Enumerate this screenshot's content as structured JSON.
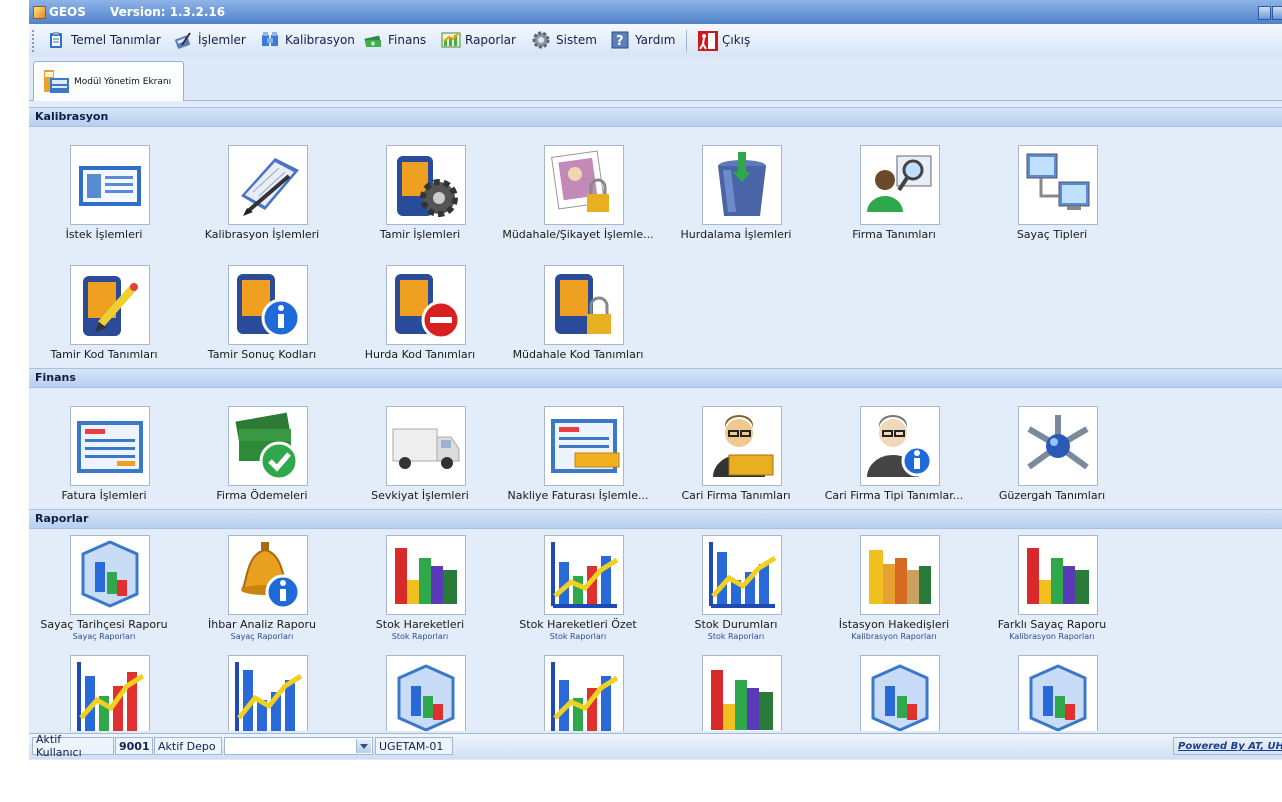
{
  "window": {
    "app_name": "GEOS",
    "version": "Version: 1.3.2.16"
  },
  "menu": [
    {
      "label": "Temel Tanımlar",
      "icon": "clipboard-icon"
    },
    {
      "label": "İşlemler",
      "icon": "calculator-pen-icon"
    },
    {
      "label": "Kalibrasyon",
      "icon": "meter-icon"
    },
    {
      "label": "Finans",
      "icon": "money-icon"
    },
    {
      "label": "Raporlar",
      "icon": "chart-icon"
    },
    {
      "label": "Sistem",
      "icon": "gear-icon"
    },
    {
      "label": "Yardım",
      "icon": "help-icon"
    },
    {
      "label": "Çıkış",
      "icon": "exit-icon"
    }
  ],
  "tab": {
    "label": "Modül Yönetim Ekranı"
  },
  "sections": [
    {
      "title": "Kalibrasyon",
      "items": [
        {
          "label": "İstek İşlemleri",
          "icon": "document-list-icon"
        },
        {
          "label": "Kalibrasyon İşlemleri",
          "icon": "notebook-pen-icon"
        },
        {
          "label": "Tamir İşlemleri",
          "icon": "device-gear-icon"
        },
        {
          "label": "Müdahale/Şikayet İşlemle...",
          "icon": "photo-lock-icon"
        },
        {
          "label": "Hurdalama İşlemleri",
          "icon": "recycle-bin-icon"
        },
        {
          "label": "Firma Tanımları",
          "icon": "person-search-icon"
        },
        {
          "label": "Sayaç Tipleri",
          "icon": "network-computers-icon"
        },
        {
          "label": "Tamir Kod Tanımları",
          "icon": "device-pencil-icon"
        },
        {
          "label": "Tamir Sonuç Kodları",
          "icon": "device-info-icon"
        },
        {
          "label": "Hurda Kod Tanımları",
          "icon": "device-stop-icon"
        },
        {
          "label": "Müdahale Kod Tanımları",
          "icon": "device-lock-icon"
        }
      ]
    },
    {
      "title": "Finans",
      "items": [
        {
          "label": "Fatura İşlemleri",
          "icon": "invoice-icon"
        },
        {
          "label": "Firma Ödemeleri",
          "icon": "money-check-icon"
        },
        {
          "label": "Sevkiyat İşlemleri",
          "icon": "delivery-truck-icon"
        },
        {
          "label": "Nakliye Faturası İşlemle...",
          "icon": "invoice-card-icon"
        },
        {
          "label": "Cari Firma Tanımları",
          "icon": "user-folder-icon"
        },
        {
          "label": "Cari Firma Tipi Tanımlar...",
          "icon": "user-info-icon"
        },
        {
          "label": "Güzergah Tanımları",
          "icon": "routes-hub-icon"
        }
      ]
    },
    {
      "title": "Raporlar",
      "items": [
        {
          "label": "Sayaç Tarihçesi Raporu",
          "sub": "Sayaç Raporları",
          "icon": "chart-3d-icon"
        },
        {
          "label": "İhbar Analiz Raporu",
          "sub": "Sayaç Raporları",
          "icon": "bell-info-icon"
        },
        {
          "label": "Stok Hareketleri",
          "sub": "Stok Raporları",
          "icon": "bar-chart-icon"
        },
        {
          "label": "Stok Hareketleri Özet",
          "sub": "Stok Raporları",
          "icon": "line-chart-icon"
        },
        {
          "label": "Stok Durumları",
          "sub": "Stok Raporları",
          "icon": "line-chart-icon"
        },
        {
          "label": "İstasyon Hakedişleri",
          "sub": "Kalibrasyon Raporları",
          "icon": "bar-chart-warm-icon"
        },
        {
          "label": "Farklı Sayaç Raporu",
          "sub": "Kalibrasyon Raporları",
          "icon": "bar-chart-icon"
        },
        {
          "label": "",
          "sub": "",
          "icon": "line-chart-icon"
        },
        {
          "label": "",
          "sub": "",
          "icon": "line-chart-icon"
        },
        {
          "label": "",
          "sub": "",
          "icon": "chart-3d-icon"
        },
        {
          "label": "",
          "sub": "",
          "icon": "line-chart-icon"
        },
        {
          "label": "",
          "sub": "",
          "icon": "bar-chart-icon"
        },
        {
          "label": "",
          "sub": "",
          "icon": "chart-3d-icon"
        },
        {
          "label": "",
          "sub": "",
          "icon": "chart-3d-icon"
        }
      ]
    }
  ],
  "status": {
    "user_label": "Aktif Kullanıcı",
    "user_value": "9001",
    "depot_label": "Aktif Depo",
    "depot_value": "",
    "station": "UGETAM-01",
    "powered": "Powered By AT, UH,"
  }
}
